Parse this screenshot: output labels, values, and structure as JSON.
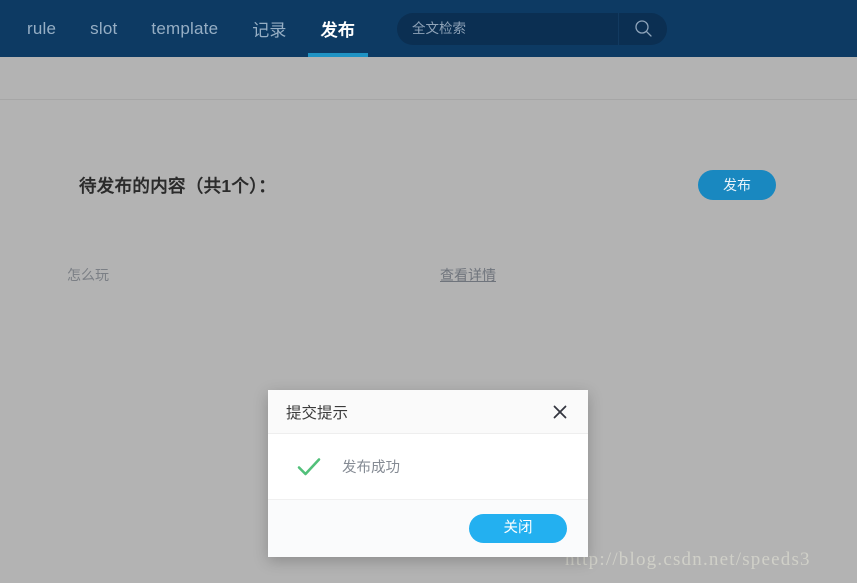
{
  "topbar": {
    "nav": [
      {
        "label": "rule",
        "active": false
      },
      {
        "label": "slot",
        "active": false
      },
      {
        "label": "template",
        "active": false
      },
      {
        "label": "记录",
        "active": false
      },
      {
        "label": "发布",
        "active": true
      }
    ],
    "search": {
      "placeholder": "全文检索",
      "value": "",
      "icon": "search-icon"
    },
    "colors": {
      "background": "#0d3a63",
      "search_background": "#0b2f52",
      "active_underline": "#1f93c4",
      "active_text": "#ffffff",
      "inactive_text": "#96aec4"
    }
  },
  "main": {
    "title": "待发布的内容（共1个）：",
    "count": 1,
    "publish_button": "发布",
    "rows": [
      {
        "label": "怎么玩",
        "detail_link": "查看详情"
      }
    ],
    "colors": {
      "page_background": "#b3b3b3",
      "publish_button": "#1988c0",
      "title_text": "#2b2b2b"
    }
  },
  "modal": {
    "title": "提交提示",
    "close_icon": "close-icon",
    "status_icon": "check-icon",
    "message": "发布成功",
    "footer_button": "关闭",
    "colors": {
      "header_background": "#fafafa",
      "body_background": "#ffffff",
      "footer_background": "#fafbfc",
      "check": "#52c07a",
      "button": "#23b0f0"
    }
  },
  "watermark": {
    "text": "http://blog.csdn.net/speeds3"
  }
}
